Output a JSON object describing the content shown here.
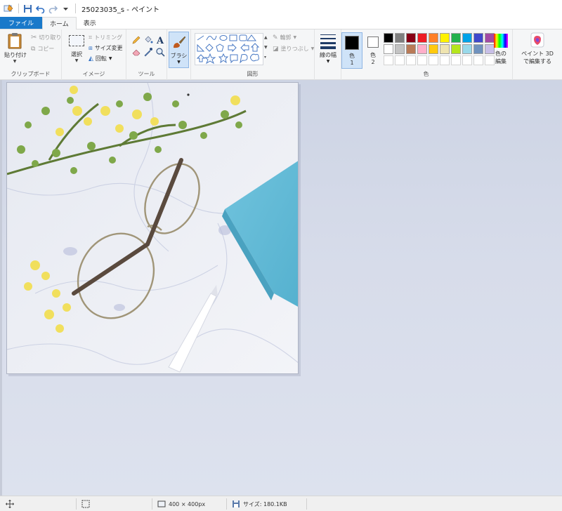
{
  "titlebar": {
    "title": "25023035_s - ペイント"
  },
  "tabs": [
    {
      "label": "ファイル"
    },
    {
      "label": "ホーム"
    },
    {
      "label": "表示"
    }
  ],
  "ribbon": {
    "clipboard": {
      "paste": "貼り付け",
      "cut": "切り取り",
      "copy": "コピー",
      "label": "クリップボード"
    },
    "image": {
      "select": "選択",
      "crop": "トリミング",
      "resize": "サイズ変更",
      "rotate": "回転",
      "label": "イメージ"
    },
    "tools": {
      "label": "ツール"
    },
    "brushes": {
      "label": "ブラシ"
    },
    "shapes": {
      "outline": "輪郭",
      "fill": "塗りつぶし",
      "label": "図形"
    },
    "size": {
      "label": "線の幅"
    },
    "color1": {
      "label": "色",
      "num": "1"
    },
    "color2": {
      "label": "色",
      "num": "2"
    },
    "colors": {
      "label": "色",
      "edit_line1": "色の",
      "edit_line2": "編集"
    },
    "paint3d": {
      "line1": "ペイント 3D",
      "line2": "で編集する"
    }
  },
  "palette": [
    "#000000",
    "#7f7f7f",
    "#880015",
    "#ed1c24",
    "#ff7f27",
    "#fff200",
    "#22b14c",
    "#00a2e8",
    "#3f48cc",
    "#a349a4",
    "#ffffff",
    "#c3c3c3",
    "#b97a57",
    "#ffaec9",
    "#ffc90e",
    "#efe4b0",
    "#b5e61d",
    "#99d9ea",
    "#7092be",
    "#c8bfe7"
  ],
  "status": {
    "dimensions": "400 × 400px",
    "size": "サイズ: 180.1KB"
  }
}
